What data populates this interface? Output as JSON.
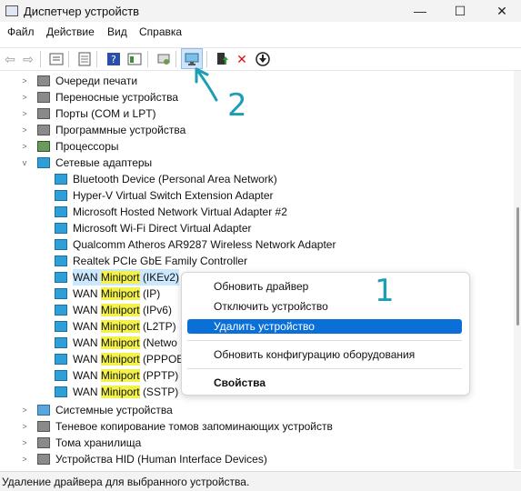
{
  "window": {
    "title": "Диспетчер устройств",
    "minimize": "—",
    "maximize": "☐",
    "close": "✕"
  },
  "menu": [
    "Файл",
    "Действие",
    "Вид",
    "Справка"
  ],
  "toolbar_icons": [
    "back-icon",
    "forward-icon",
    "properties-icon",
    "console-tree-icon",
    "help-icon",
    "view-icon",
    "scan-hardware-icon",
    "monitor-icon",
    "update-driver-icon",
    "uninstall-icon",
    "disable-icon"
  ],
  "tree": {
    "categories_top": [
      {
        "label": "Очереди печати",
        "icon": "printer-icon"
      },
      {
        "label": "Переносные устройства",
        "icon": "portable-device-icon"
      },
      {
        "label": "Порты (COM и LPT)",
        "icon": "port-icon"
      },
      {
        "label": "Программные устройства",
        "icon": "software-device-icon"
      },
      {
        "label": "Процессоры",
        "icon": "processor-icon"
      }
    ],
    "network_category": "Сетевые адаптеры",
    "adapters": [
      "Bluetooth Device (Personal Area Network)",
      "Hyper-V Virtual Switch Extension Adapter",
      "Microsoft Hosted Network Virtual Adapter #2",
      "Microsoft Wi-Fi Direct Virtual Adapter",
      "Qualcomm Atheros AR9287 Wireless Network Adapter",
      "Realtek PCIe GbE Family Controller"
    ],
    "wan_prefix": "WAN",
    "wan_highlight": "Miniport",
    "wan_items": [
      "(IKEv2)",
      "(IP)",
      "(IPv6)",
      "(L2TP)",
      "(Netwo",
      "(PPPOE",
      "(PPTP)",
      "(SSTP)"
    ],
    "categories_bottom": [
      {
        "label": "Системные устройства",
        "icon": "system-device-icon"
      },
      {
        "label": "Теневое копирование томов запоминающих устройств",
        "icon": "storage-icon"
      },
      {
        "label": "Тома хранилища",
        "icon": "volume-icon"
      },
      {
        "label": "Устройства HID (Human Interface Devices)",
        "icon": "hid-icon"
      }
    ]
  },
  "context_menu": {
    "update_driver": "Обновить драйвер",
    "disable_device": "Отключить устройство",
    "uninstall_device": "Удалить устройство",
    "scan_hardware": "Обновить конфигурацию оборудования",
    "properties": "Свойства"
  },
  "annotations": {
    "one": "1",
    "two": "2"
  },
  "status": "Удаление драйвера для выбранного устройства.",
  "colors": {
    "accent": "#0a6fd6",
    "highlight": "#f3f24a",
    "annotation": "#1a9fb6"
  }
}
